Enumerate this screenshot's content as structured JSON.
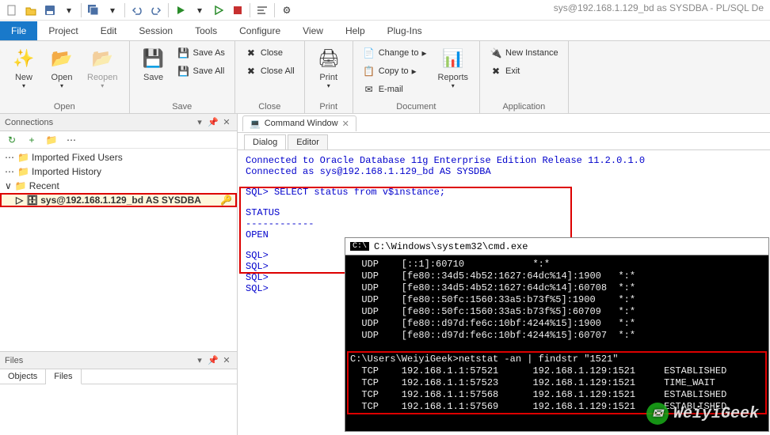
{
  "window_title": "sys@192.168.1.129_bd as SYSDBA - PL/SQL De",
  "menu": {
    "file": "File",
    "project": "Project",
    "edit": "Edit",
    "session": "Session",
    "tools": "Tools",
    "configure": "Configure",
    "view": "View",
    "help": "Help",
    "plugins": "Plug-Ins"
  },
  "ribbon": {
    "open_group": {
      "new": "New",
      "open": "Open",
      "reopen": "Reopen",
      "label": "Open"
    },
    "save_group": {
      "save": "Save",
      "saveas": "Save As",
      "saveall": "Save All",
      "label": "Save"
    },
    "close_group": {
      "close": "Close",
      "closeall": "Close All",
      "label": "Close"
    },
    "print_group": {
      "print": "Print",
      "label": "Print"
    },
    "doc_group": {
      "change": "Change to",
      "copy": "Copy to",
      "email": "E-mail",
      "reports": "Reports",
      "label": "Document"
    },
    "app_group": {
      "newinst": "New Instance",
      "exit": "Exit",
      "label": "Application"
    }
  },
  "connections": {
    "title": "Connections",
    "items": [
      "Imported Fixed Users",
      "Imported History",
      "Recent"
    ],
    "selected": "sys@192.168.1.129_bd AS SYSDBA"
  },
  "files": {
    "title": "Files",
    "tabs": [
      "Objects",
      "Files"
    ],
    "selected": 1
  },
  "command_window": {
    "tab": "Command Window",
    "subtabs": [
      "Dialog",
      "Editor"
    ],
    "lines": {
      "l1": "Connected to Oracle Database 11g Enterprise Edition Release 11.2.0.1.0",
      "l2": "Connected as sys@192.168.1.129_bd AS SYSDBA",
      "l3": "SQL> SELECT status from v$instance;",
      "l4": "STATUS",
      "l5": "------------",
      "l6": "OPEN",
      "l7": "SQL>",
      "l8": "SQL>",
      "l9": "SQL>",
      "l10": "SQL>"
    }
  },
  "cmd": {
    "title": "C:\\Windows\\system32\\cmd.exe",
    "body": "  UDP    [::1]:60710            *:*\n  UDP    [fe80::34d5:4b52:1627:64dc%14]:1900   *:*\n  UDP    [fe80::34d5:4b52:1627:64dc%14]:60708  *:*\n  UDP    [fe80::50fc:1560:33a5:b73f%5]:1900    *:*\n  UDP    [fe80::50fc:1560:33a5:b73f%5]:60709   *:*\n  UDP    [fe80::d97d:fe6c:10bf:4244%15]:1900   *:*\n  UDP    [fe80::d97d:fe6c:10bf:4244%15]:60707  *:*\n\nC:\\Users\\WeiyiGeek>netstat -an | findstr \"1521\"\n  TCP    192.168.1.1:57521      192.168.1.129:1521     ESTABLISHED\n  TCP    192.168.1.1:57523      192.168.1.129:1521     TIME_WAIT\n  TCP    192.168.1.1:57568      192.168.1.129:1521     ESTABLISHED\n  TCP    192.168.1.1:57569      192.168.1.129:1521     ESTABLISHED"
  },
  "watermark": "WeiyiGeek"
}
